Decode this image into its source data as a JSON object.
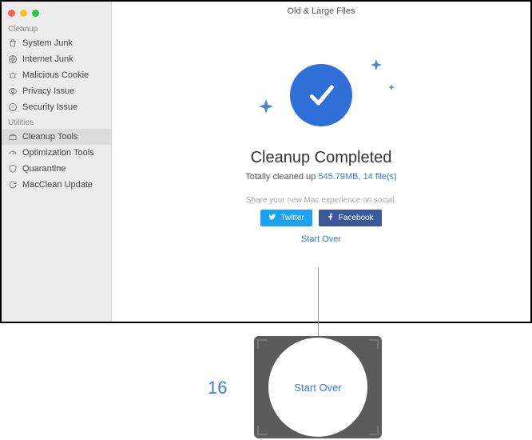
{
  "window": {
    "title": "Old & Large Files"
  },
  "sidebar": {
    "sections": {
      "cleanup": {
        "title": "Cleanup"
      },
      "utilities": {
        "title": "Utilities"
      }
    },
    "cleanup_items": [
      {
        "label": "System Junk"
      },
      {
        "label": "Internet Junk"
      },
      {
        "label": "Malicious Cookie"
      },
      {
        "label": "Privacy Issue"
      },
      {
        "label": "Security Issue"
      }
    ],
    "utility_items": [
      {
        "label": "Cleanup Tools"
      },
      {
        "label": "Optimization Tools"
      },
      {
        "label": "Quarantine"
      },
      {
        "label": "MacClean Update"
      }
    ],
    "active_utility_index": 0
  },
  "result": {
    "headline": "Cleanup Completed",
    "subline_prefix": "Totally cleaned up ",
    "stat": "545.79MB, 14 file(s)"
  },
  "share": {
    "prompt": "Share your new Mac experience on social.",
    "twitter": "Twitter",
    "facebook": "Facebook"
  },
  "actions": {
    "start_over": "Start Over"
  },
  "callout": {
    "number": "16",
    "label": "Start Over"
  }
}
